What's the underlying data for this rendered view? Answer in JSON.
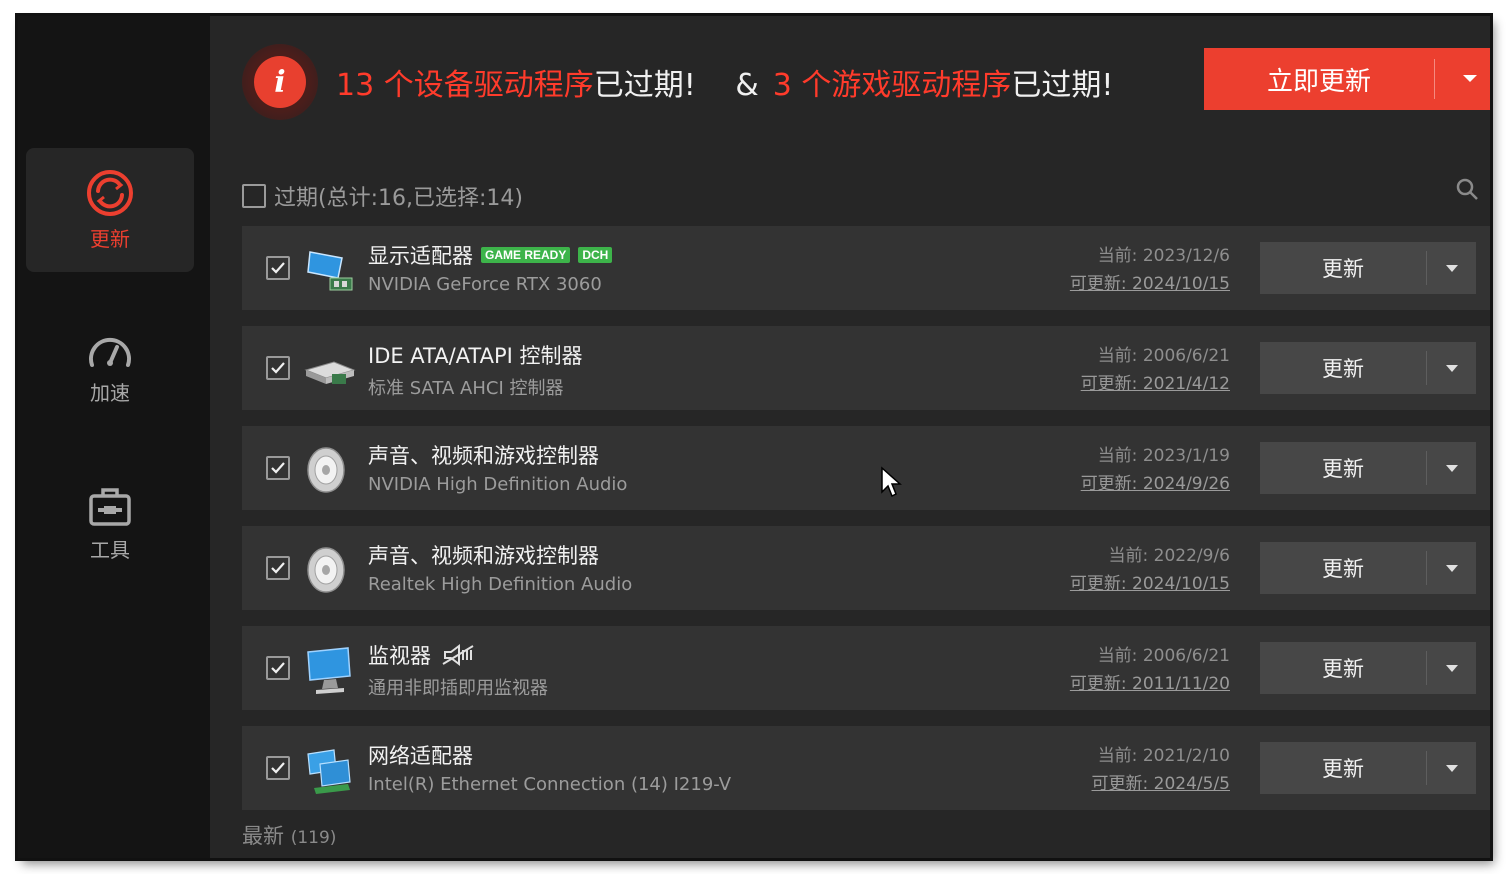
{
  "sidebar": {
    "items": [
      {
        "label": "更新",
        "icon": "refresh-icon",
        "active": true
      },
      {
        "label": "加速",
        "icon": "speedometer-icon",
        "active": false
      },
      {
        "label": "工具",
        "icon": "toolbox-icon",
        "active": false
      }
    ]
  },
  "banner": {
    "device_count": "13",
    "device_text": "个设备驱动程序",
    "expired_1": "已过期!",
    "amp": "&",
    "game_count": "3",
    "game_text": "个游戏驱动程序",
    "expired_2": "已过期!",
    "update_now_label": "立即更新"
  },
  "section": {
    "label": "过期",
    "summary": "(总计:16,已选择:14)"
  },
  "devices": [
    {
      "name": "显示适配器",
      "tags": [
        "GAME READY",
        "DCH"
      ],
      "sub": "NVIDIA GeForce RTX 3060",
      "current": "当前: 2023/12/6",
      "available": "可更新: 2024/10/15",
      "icon": "display-adapter-icon",
      "checked": true
    },
    {
      "name": "IDE ATA/ATAPI 控制器",
      "tags": [],
      "sub": "标准 SATA AHCI 控制器",
      "current": "当前: 2006/6/21",
      "available": "可更新: 2021/4/12",
      "icon": "storage-controller-icon",
      "checked": true
    },
    {
      "name": "声音、视频和游戏控制器",
      "tags": [],
      "sub": "NVIDIA High Definition Audio",
      "current": "当前: 2023/1/19",
      "available": "可更新: 2024/9/26",
      "icon": "speaker-icon",
      "checked": true
    },
    {
      "name": "声音、视频和游戏控制器",
      "tags": [],
      "sub": "Realtek High Definition Audio",
      "current": "当前: 2022/9/6",
      "available": "可更新: 2024/10/15",
      "icon": "speaker-icon",
      "checked": true
    },
    {
      "name": "监视器",
      "tags": [],
      "sub": "通用非即插即用监视器",
      "current": "当前: 2006/6/21",
      "available": "可更新: 2011/11/20",
      "icon": "monitor-icon",
      "checked": true
    },
    {
      "name": "网络适配器",
      "tags": [],
      "sub": "Intel(R) Ethernet Connection (14) I219-V",
      "current": "当前: 2021/2/10",
      "available": "可更新: 2024/5/5",
      "icon": "network-adapter-icon",
      "checked": true
    }
  ],
  "row_update_label": "更新",
  "latest": {
    "label": "最新",
    "count": "(119)"
  },
  "colors": {
    "accent": "#ec3f2f",
    "background": "#262626",
    "sidebar": "#141414",
    "row": "#333333",
    "tag": "#3db44a"
  }
}
